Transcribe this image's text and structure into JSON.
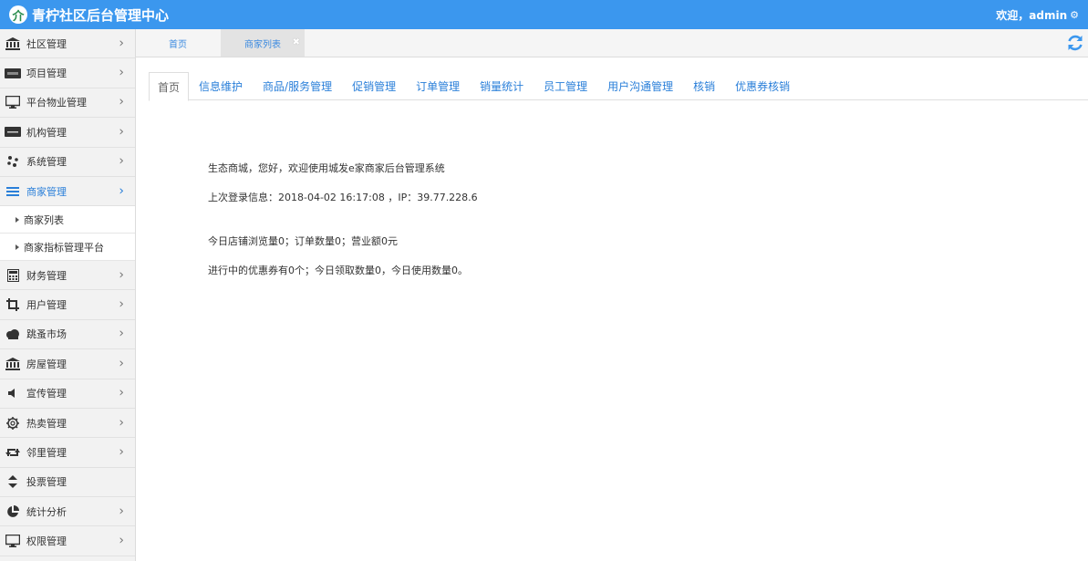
{
  "header": {
    "title": "青柠社区后台管理中心",
    "user": "欢迎，admin"
  },
  "sidebar": {
    "items_top": [
      {
        "label": "社区管理"
      },
      {
        "label": "项目管理"
      },
      {
        "label": "平台物业管理"
      },
      {
        "label": "机构管理"
      },
      {
        "label": "系统管理"
      },
      {
        "label": "商家管理"
      }
    ],
    "sub_items": [
      {
        "label": "商家列表"
      },
      {
        "label": "商家指标管理平台"
      }
    ],
    "items_bottom": [
      {
        "label": "财务管理"
      },
      {
        "label": "用户管理"
      },
      {
        "label": "跳蚤市场"
      },
      {
        "label": "房屋管理"
      },
      {
        "label": "宣传管理"
      },
      {
        "label": "热卖管理"
      },
      {
        "label": "邻里管理"
      },
      {
        "label": "投票管理"
      },
      {
        "label": "统计分析"
      },
      {
        "label": "权限管理"
      }
    ]
  },
  "page_tabs": [
    {
      "label": "首页"
    },
    {
      "label": "商家列表"
    }
  ],
  "inner_tabs": [
    {
      "label": "首页"
    },
    {
      "label": "信息维护"
    },
    {
      "label": "商品/服务管理"
    },
    {
      "label": "促销管理"
    },
    {
      "label": "订单管理"
    },
    {
      "label": "销量统计"
    },
    {
      "label": "员工管理"
    },
    {
      "label": "用户沟通管理"
    },
    {
      "label": "核销"
    },
    {
      "label": "优惠券核销"
    }
  ],
  "info": {
    "welcome": "生态商城，您好，欢迎使用城发e家商家后台管理系统",
    "last_login": "上次登录信息：2018-04-02 16:17:08 ，IP：39.77.228.6",
    "today_stats": "今日店铺浏览量0；订单数量0；营业额0元",
    "coupon_stats": "进行中的优惠券有0个；今日领取数量0，今日使用数量0。"
  },
  "colors": {
    "header": "#3b97ee",
    "link": "#2a7fd9"
  }
}
